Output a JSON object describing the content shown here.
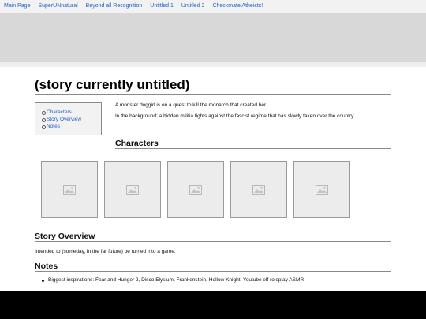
{
  "nav": {
    "items": [
      {
        "label": "Main Page"
      },
      {
        "label": "SuperUNnatural"
      },
      {
        "label": "Beyond all Recognition"
      },
      {
        "label": "Untitled 1"
      },
      {
        "label": "Untitled 2"
      },
      {
        "label": "Checkmate Atheists!"
      }
    ]
  },
  "page": {
    "title": "(story currently untitled)"
  },
  "toc": {
    "items": [
      {
        "label": "Characters"
      },
      {
        "label": "Story Overview"
      },
      {
        "label": "Notes"
      }
    ]
  },
  "intro": {
    "line1": "A monster doggirl is on a quest to kill the monarch that created her.",
    "line2": "In the background: a hidden militia fights against the fascist regime that has slowly taken over the country."
  },
  "characters": {
    "heading": "Characters",
    "images": [
      {
        "icon": "image-placeholder-icon"
      },
      {
        "icon": "image-placeholder-icon"
      },
      {
        "icon": "image-placeholder-icon"
      },
      {
        "icon": "image-placeholder-icon"
      },
      {
        "icon": "image-placeholder-icon"
      }
    ]
  },
  "overview": {
    "heading": "Story Overview",
    "text": "Intended to (someday, in the far future) be turned into a game."
  },
  "notes": {
    "heading": "Notes",
    "items": [
      {
        "text": "Biggest inspirations: Fear and Hunger 2, Disco Elysium, Frankenstein, Hollow Knight, Youtube elf roleplay ASMR"
      }
    ]
  },
  "colors": {
    "link": "#2463c0",
    "banner": "#d8d8d8",
    "bottom_bar": "#000000"
  }
}
